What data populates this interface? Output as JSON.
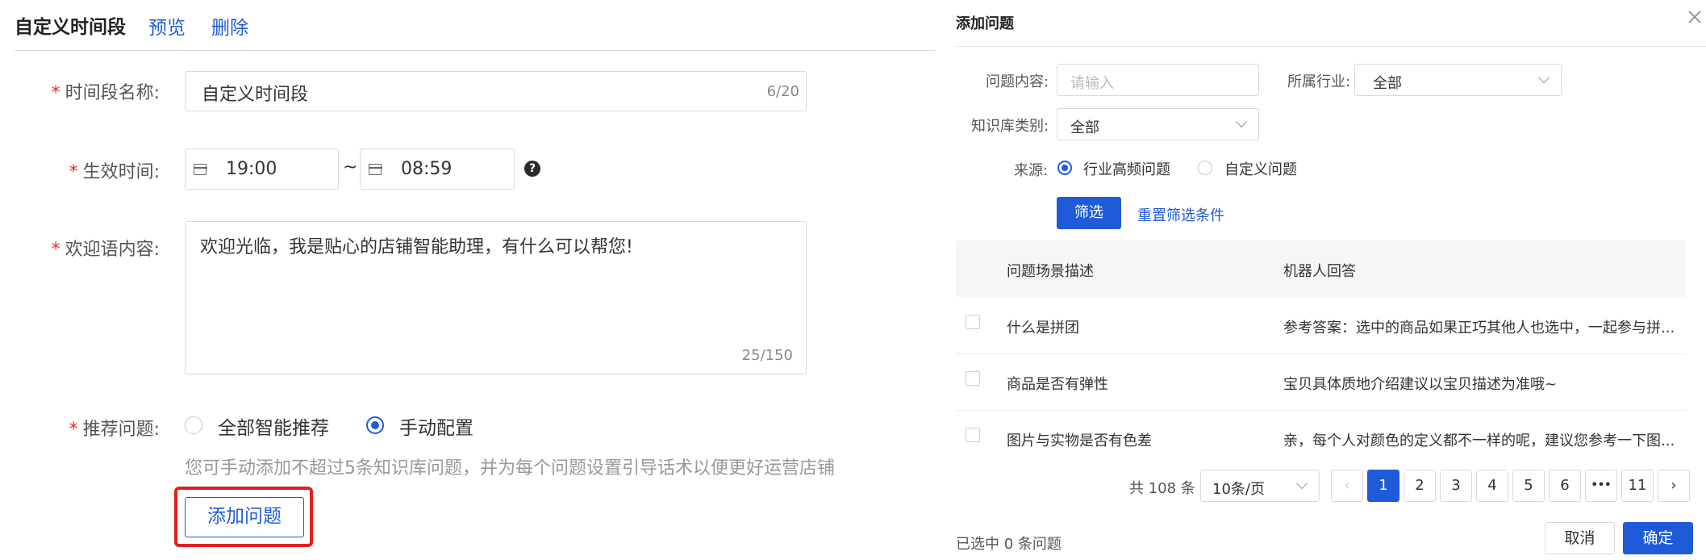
{
  "left": {
    "title": "自定义时间段",
    "preview_label": "预览",
    "delete_label": "删除",
    "name_label": "时间段名称:",
    "name_value": "自定义时间段",
    "name_count": "6/20",
    "time_label": "生效时间:",
    "time_start": "19:00",
    "time_sep": "~",
    "time_end": "08:59",
    "welcome_label": "欢迎语内容:",
    "welcome_value": "欢迎光临，我是贴心的店铺智能助理，有什么可以帮您!",
    "welcome_count": "25/150",
    "recommend_label": "推荐问题:",
    "option_all": "全部智能推荐",
    "option_manual": "手动配置",
    "hint": "您可手动添加不超过5条知识库问题，并为每个问题设置引导话术以便更好运营店铺",
    "add_button": "添加问题",
    "required_mark": "*"
  },
  "dialog": {
    "title": "添加问题",
    "close_icon": "close-icon",
    "q_content_label": "问题内容:",
    "q_content_placeholder": "请输入",
    "industry_label": "所属行业:",
    "industry_value": "全部",
    "kb_label": "知识库类别:",
    "kb_value": "全部",
    "source_label": "来源:",
    "source_opt1": "行业高频问题",
    "source_opt2": "自定义问题",
    "filter_button": "筛选",
    "reset_link": "重置筛选条件",
    "col_scene": "问题场景描述",
    "col_answer": "机器人回答",
    "rows": [
      {
        "scene": "什么是拼团",
        "answer": "参考答案：选中的商品如果正巧其他人也选中，一起参与拼..."
      },
      {
        "scene": "商品是否有弹性",
        "answer": "宝贝具体质地介绍建议以宝贝描述为准哦~"
      },
      {
        "scene": "图片与实物是否有色差",
        "answer": "亲，每个人对颜色的定义都不一样的呢，建议您参考一下图..."
      }
    ],
    "total": "共 108 条",
    "page_size": "10条/页",
    "pages": [
      "1",
      "2",
      "3",
      "4",
      "5",
      "6",
      "•••",
      "11"
    ],
    "current_page": "1",
    "selected_text": "已选中 0 条问题",
    "cancel_button": "取消",
    "confirm_button": "确定"
  },
  "colors": {
    "accent": "#1f5bd8",
    "required": "#e0301e",
    "highlight_box": "#e02020"
  }
}
